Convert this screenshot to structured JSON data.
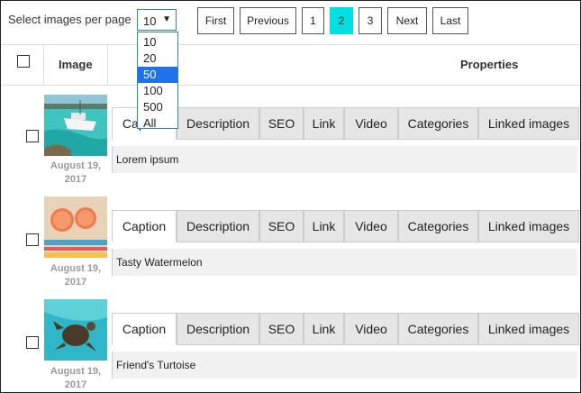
{
  "toolbar": {
    "label": "Select images per page",
    "selected": "10",
    "options": [
      "10",
      "20",
      "50",
      "100",
      "500",
      "All"
    ],
    "highlighted_option": "50",
    "pagination": {
      "first": "First",
      "previous": "Previous",
      "pages": [
        "1",
        "2",
        "3"
      ],
      "current_page": "2",
      "next": "Next",
      "last": "Last"
    }
  },
  "table": {
    "headers": {
      "image": "Image",
      "properties": "Properties"
    },
    "tabs": [
      "Caption",
      "Description",
      "SEO",
      "Link",
      "Video",
      "Categories",
      "Linked images"
    ],
    "rows": [
      {
        "date_line1": "August 19,",
        "date_line2": "2017",
        "caption": "Lorem ipsum",
        "thumbnail": "boat-in-turquoise-water"
      },
      {
        "date_line1": "August 19,",
        "date_line2": "2017",
        "caption": "Tasty Watermelon",
        "thumbnail": "grapefruit-slices-on-towel"
      },
      {
        "date_line1": "August 19,",
        "date_line2": "2017",
        "caption": "Friend's Turtoise",
        "thumbnail": "sea-turtle-underwater"
      }
    ]
  },
  "colors": {
    "active_page": "#00e0e0",
    "dropdown_highlight": "#1e73e8",
    "select_border": "#2f7fc1"
  }
}
